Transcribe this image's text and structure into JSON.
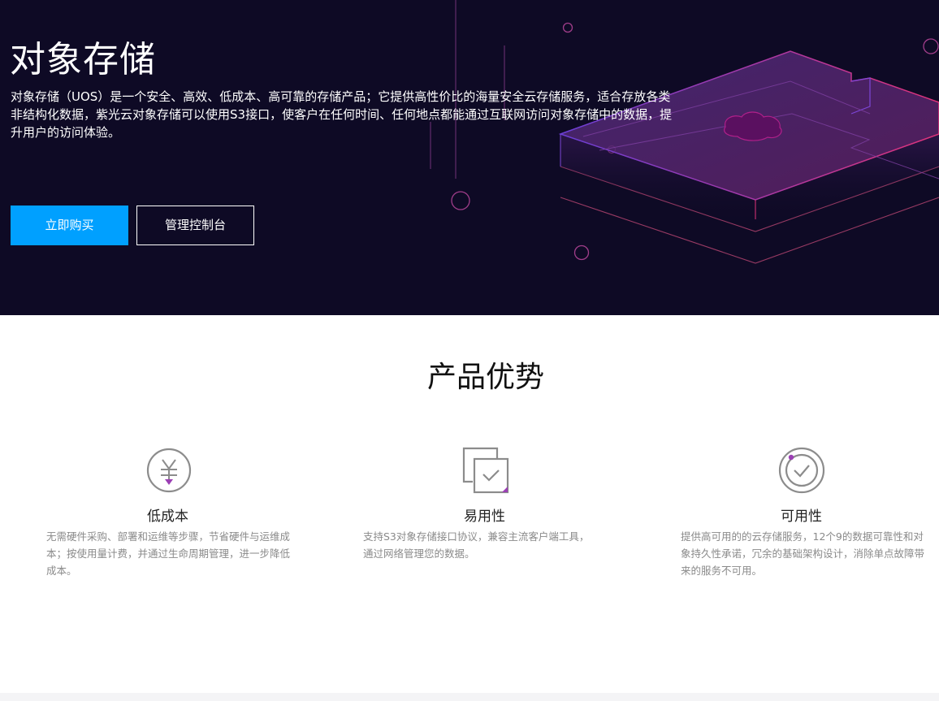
{
  "hero": {
    "title": "对象存储",
    "description": "对象存储（UOS）是一个安全、高效、低成本、高可靠的存储产品；它提供高性价比的海量安全云存储服务，适合存放各类非结构化数据，紫光云对象存储可以使用S3接口，使客户在任何时间、任何地点都能通过互联网访问对象存储中的数据，提升用户的访问体验。",
    "buy_button": "立即购买",
    "console_button": "管理控制台"
  },
  "advantages": {
    "title": "产品优势",
    "items": [
      {
        "icon": "yen-cost-icon",
        "title": "低成本",
        "description": "无需硬件采购、部署和运维等步骤，节省硬件与运维成本；按使用量计费，并通过生命周期管理，进一步降低成本。"
      },
      {
        "icon": "check-documents-icon",
        "title": "易用性",
        "description": "支持S3对象存储接口协议，兼容主流客户端工具，通过网络管理您的数据。"
      },
      {
        "icon": "check-circle-icon",
        "title": "可用性",
        "description": "提供高可用的的云存储服务，12个9的数据可靠性和对象持久性承诺，冗余的基础架构设计，消除单点故障带来的服务不可用。"
      }
    ]
  },
  "colors": {
    "hero_background": "#0e0a25",
    "primary_button": "#00a0ff",
    "accent_purple": "#9b3fb4",
    "accent_pink": "#e0337a"
  }
}
